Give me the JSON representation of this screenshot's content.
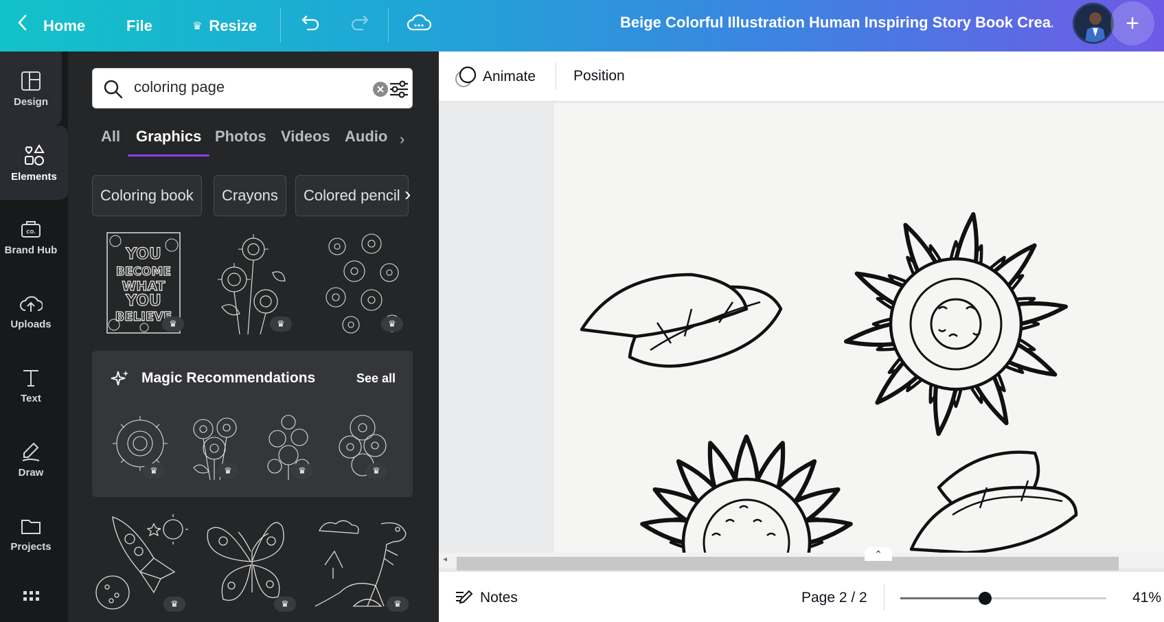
{
  "topbar": {
    "home_label": "Home",
    "file_label": "File",
    "resize_label": "Resize",
    "document_title": "Beige Colorful Illustration Human Inspiring Story Book Crea...",
    "add_label": "+"
  },
  "rail": {
    "items": [
      {
        "label": "Design",
        "icon": "layout-icon"
      },
      {
        "label": "Elements",
        "icon": "shapes-icon"
      },
      {
        "label": "Brand Hub",
        "icon": "brand-icon"
      },
      {
        "label": "Uploads",
        "icon": "cloud-upload-icon"
      },
      {
        "label": "Text",
        "icon": "text-icon"
      },
      {
        "label": "Draw",
        "icon": "pen-icon"
      },
      {
        "label": "Projects",
        "icon": "folder-icon"
      }
    ],
    "active": "Elements"
  },
  "panel": {
    "search_value": "coloring page",
    "tabs": [
      "All",
      "Graphics",
      "Photos",
      "Videos",
      "Audio"
    ],
    "active_tab": "Graphics",
    "chips": [
      "Coloring book",
      "Crayons",
      "Colored pencil"
    ],
    "thumb_text": "YOU BECOME WHAT YOU BELIEVE",
    "magic_title": "Magic Recommendations",
    "magic_see_all": "See all"
  },
  "context_bar": {
    "animate_label": "Animate",
    "position_label": "Position"
  },
  "footer": {
    "notes_label": "Notes",
    "page_indicator": "Page 2 / 2",
    "zoom_label": "41%",
    "zoom_fraction": 0.41
  },
  "colors": {
    "accent": "#8b3dff",
    "panel_bg": "#252627",
    "rail_bg": "#18191b"
  }
}
